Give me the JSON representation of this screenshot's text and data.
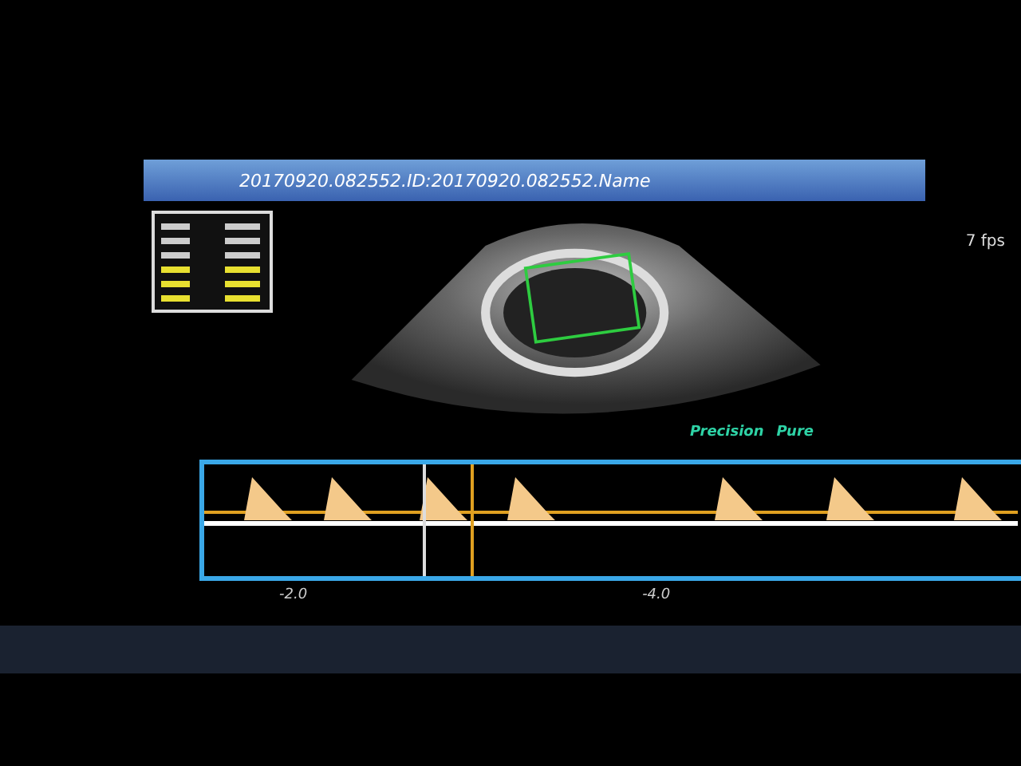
{
  "header": {
    "file_name": "20170920.082552.ID:20170920.082552.Name"
  },
  "right_panel": {
    "frame_rate": "7 fps"
  },
  "image_legend": [
    {
      "label": "Precision",
      "color": "#2ed3a6"
    },
    {
      "label": "Pure",
      "color": "#2ed3a6"
    }
  ],
  "doppler": {
    "scale_labels": [
      "-2.0",
      "-4.0"
    ]
  }
}
